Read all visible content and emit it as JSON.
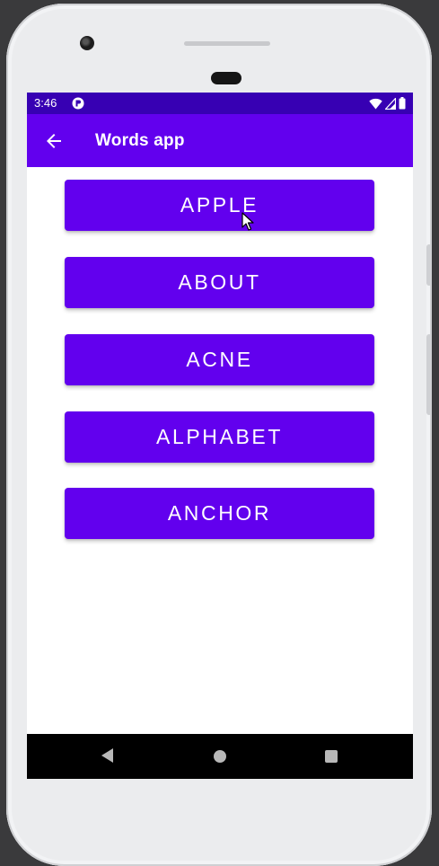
{
  "status_bar": {
    "time": "3:46",
    "bg_color": "#3700b3",
    "icons": [
      "notification-icon",
      "wifi-icon",
      "signal-icon",
      "battery-icon"
    ]
  },
  "app_bar": {
    "title": "Words app",
    "back_icon": "arrow-back-icon",
    "bg_color": "#6200ee"
  },
  "words": [
    {
      "label": "APPLE"
    },
    {
      "label": "ABOUT"
    },
    {
      "label": "ACNE"
    },
    {
      "label": "ALPHABET"
    },
    {
      "label": "ANCHOR"
    }
  ],
  "button_color": "#6200ee",
  "nav_bar": {
    "icons": [
      "nav-back-icon",
      "nav-home-icon",
      "nav-recents-icon"
    ]
  }
}
